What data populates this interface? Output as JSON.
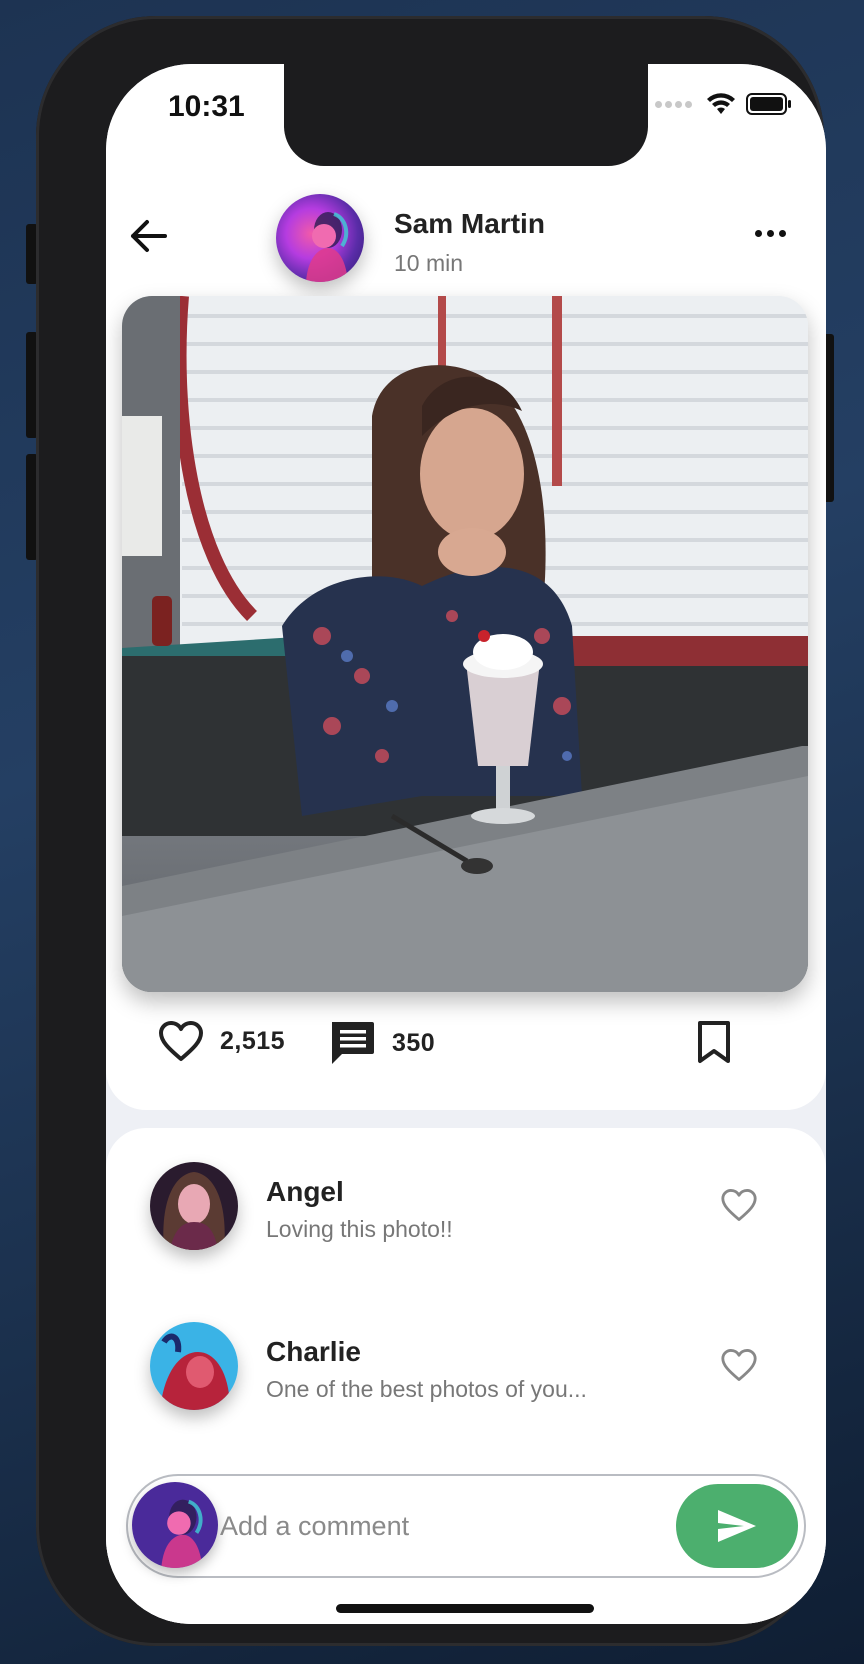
{
  "status_bar": {
    "time": "10:31"
  },
  "post": {
    "author_name": "Sam Martin",
    "time_ago": "10 min",
    "likes": "2,515",
    "comments": "350"
  },
  "comments": [
    {
      "name": "Angel",
      "text": "Loving this photo!!"
    },
    {
      "name": "Charlie",
      "text": "One of the best photos of you..."
    }
  ],
  "composer": {
    "placeholder": "Add a comment"
  },
  "colors": {
    "accent_send": "#4caf6e",
    "text_primary": "#222222",
    "text_secondary": "#777777"
  }
}
